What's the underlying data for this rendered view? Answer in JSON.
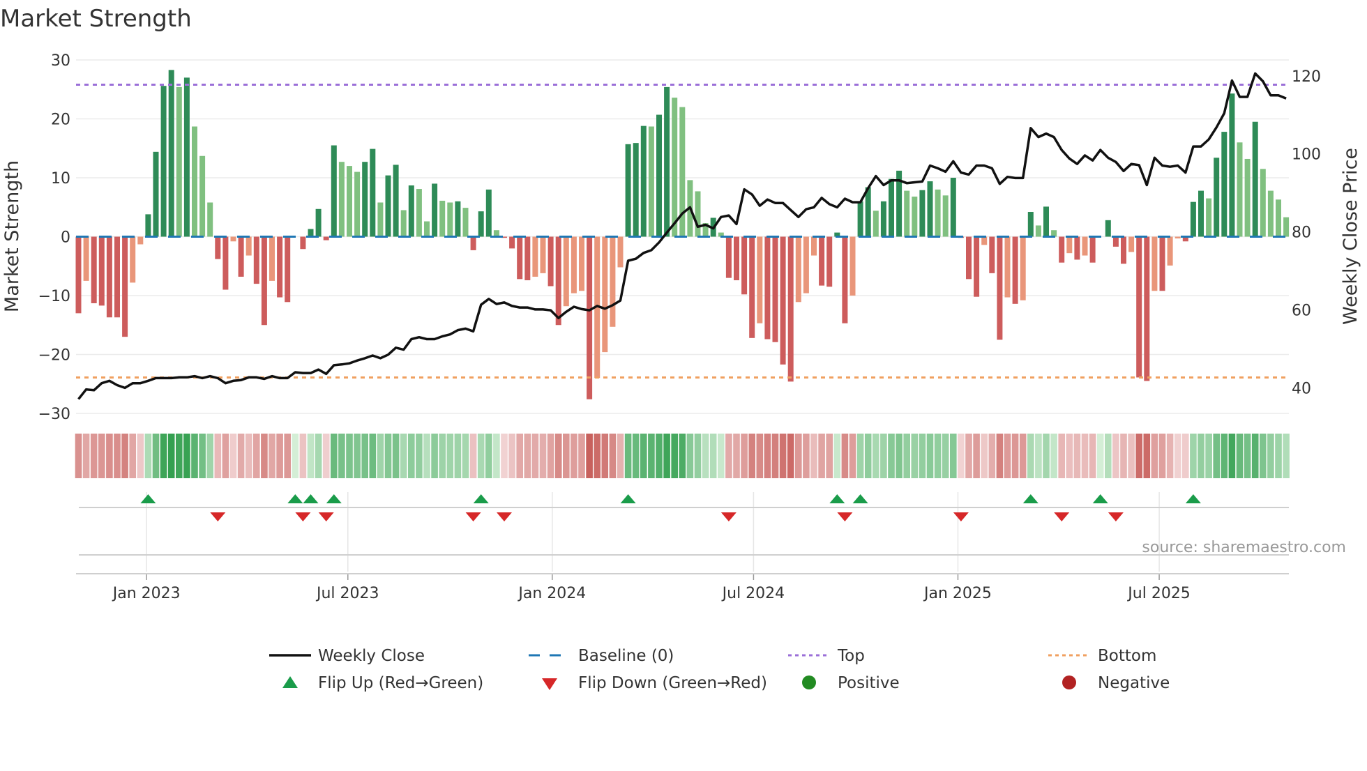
{
  "chart_data": {
    "type": "bar",
    "title": "Market Strength",
    "ylabel": "Market Strength",
    "y2label": "Weekly Close Price",
    "ylim": [
      -30,
      30
    ],
    "y2lim": [
      40,
      120
    ],
    "yticks": [
      30,
      20,
      10,
      0,
      -10,
      -20,
      -30
    ],
    "ytick_labels": [
      "30",
      "20",
      "10",
      "0",
      "−10",
      "−20",
      "−30"
    ],
    "y2ticks": [
      120,
      100,
      80,
      60,
      40
    ],
    "y2tick_labels": [
      "120",
      "100",
      "80",
      "60",
      "40"
    ],
    "xtick_labels": [
      "Jan 2023",
      "Jul 2023",
      "Jan 2024",
      "Jul 2024",
      "Jan 2025",
      "Jul 2025"
    ],
    "xtick_week_index": [
      8.8,
      34.8,
      61.2,
      87.2,
      113.6,
      139.6
    ],
    "grid": true,
    "top_level": 25.8,
    "bottom_level": -23.9,
    "baseline": 0,
    "strength": [
      -13,
      -7.5,
      -11.3,
      -11.7,
      -13.7,
      -13.7,
      -17,
      -7.8,
      -1.3,
      3.8,
      14.4,
      25.6,
      28.3,
      25.4,
      27,
      18.7,
      13.7,
      5.8,
      -3.8,
      -9,
      -0.8,
      -6.8,
      -3.2,
      -8,
      -15,
      -7.5,
      -10.3,
      -11.1,
      0,
      -2.1,
      1.3,
      4.7,
      -0.6,
      15.5,
      12.7,
      12,
      11,
      12.7,
      14.9,
      5.8,
      10.4,
      12.2,
      4.5,
      8.7,
      8.1,
      2.6,
      9,
      6.1,
      5.8,
      6,
      4.9,
      -2.3,
      4.3,
      8,
      1.1,
      -0.2,
      -2,
      -7.2,
      -7.4,
      -6.8,
      -6.2,
      -8.4,
      -15,
      -11.8,
      -9.6,
      -9.2,
      -27.6,
      -24,
      -19.6,
      -15.3,
      -5.2,
      15.7,
      15.9,
      18.8,
      18.7,
      20.7,
      25.4,
      23.6,
      22,
      9.6,
      7.7,
      2.3,
      3.2,
      0.7,
      -7,
      -7.4,
      -9.8,
      -17.2,
      -14.7,
      -17.4,
      -17.9,
      -21.7,
      -24.6,
      -11.1,
      -9.6,
      -3.2,
      -8.3,
      -8.5,
      0.7,
      -14.7,
      -10,
      6,
      8.4,
      4.4,
      6,
      9.8,
      11.2,
      7.8,
      6.8,
      7.9,
      9.4,
      8,
      7,
      10,
      -0.2,
      -7.2,
      -10.2,
      -1.4,
      -6.2,
      -17.5,
      -10.3,
      -11.4,
      -10.8,
      4.2,
      1.9,
      5.1,
      1.1,
      -4.4,
      -2.8,
      -3.9,
      -3.2,
      -4.4,
      0,
      2.8,
      -1.7,
      -4.6,
      -2.6,
      -23.9,
      -24.5,
      -9.2,
      -9.2,
      -4.9,
      -0.3,
      -0.8,
      5.9,
      7.8,
      6.5,
      13.4,
      17.8,
      24.3,
      16,
      13.2,
      19.5,
      11.5,
      7.8,
      6.3,
      3.3
    ],
    "weekly_close": [
      37.1,
      39.6,
      39.4,
      41.2,
      41.8,
      40.7,
      40,
      41.2,
      41.2,
      41.8,
      42.5,
      42.5,
      42.5,
      42.7,
      42.7,
      43,
      42.5,
      43,
      42.5,
      41.2,
      41.8,
      42,
      42.7,
      42.7,
      42.3,
      43,
      42.5,
      42.5,
      44,
      43.8,
      43.8,
      44.7,
      43.6,
      45.8,
      46,
      46.3,
      47,
      47.6,
      48.3,
      47.6,
      48.5,
      50.3,
      49.8,
      52.5,
      53,
      52.5,
      52.5,
      53.2,
      53.7,
      54.8,
      55.2,
      54.5,
      61.3,
      62.8,
      61.5,
      61.9,
      61,
      60.6,
      60.6,
      60.1,
      60.1,
      59.9,
      57.9,
      59.5,
      60.8,
      60.2,
      59.9,
      61,
      60.3,
      61.2,
      62.4,
      72.6,
      73.1,
      74.6,
      75.3,
      77.3,
      79.8,
      82.2,
      84.7,
      86.3,
      81.3,
      81.8,
      80.9,
      83.8,
      84.2,
      82,
      90.9,
      89.6,
      86.7,
      88.3,
      87.4,
      87.4,
      85.6,
      83.8,
      85.8,
      86.3,
      88.7,
      87.1,
      86.3,
      88.5,
      87.6,
      87.6,
      91.2,
      94.3,
      92,
      93.2,
      93.2,
      92.5,
      92.7,
      92.9,
      97,
      96.3,
      95.4,
      98.1,
      95.2,
      94.7,
      97,
      97,
      96.3,
      92.3,
      94.1,
      93.8,
      93.8,
      106.6,
      104.3,
      105.2,
      104.3,
      101,
      98.8,
      97.4,
      99.6,
      98.3,
      101,
      99,
      97.9,
      95.6,
      97.4,
      97.1,
      92,
      99,
      97,
      96.7,
      97,
      95.2,
      101.9,
      101.9,
      103.7,
      106.8,
      110.4,
      118.8,
      114.6,
      114.6,
      120.6,
      118.6,
      115,
      115,
      114.2
    ],
    "flip_up_week_index": [
      9,
      28,
      30,
      33,
      52,
      71,
      98,
      101,
      123,
      132,
      144
    ],
    "flip_down_week_index": [
      18,
      29,
      32,
      51,
      55,
      84,
      99,
      114,
      127,
      134
    ],
    "legend": {
      "placement": "bottom",
      "items": [
        {
          "label": "Weekly Close",
          "marker": "line-solid"
        },
        {
          "label": "Baseline (0)",
          "marker": "line-dashed"
        },
        {
          "label": "Top",
          "marker": "line-dotted"
        },
        {
          "label": "Bottom",
          "marker": "line-dotted"
        },
        {
          "label": "Flip Up (Red→Green)",
          "marker": "triangle-up"
        },
        {
          "label": "Flip Down (Green→Red)",
          "marker": "triangle-down"
        },
        {
          "label": "Positive",
          "marker": "circle"
        },
        {
          "label": "Negative",
          "marker": "circle"
        }
      ]
    },
    "annotation": "source: sharemaestro.com"
  },
  "colors": {
    "green_strong": "#2e8b57",
    "green_weak": "#80c080",
    "red_strong": "#cd5c5c",
    "red_weak": "#e9967a",
    "close_line": "#111111",
    "baseline": "#1f77b4",
    "top": "#9b6fd8",
    "bottom": "#f0a060",
    "flip_up": "#1a9c4a",
    "flip_down": "#d62728",
    "positive": "#228b22",
    "negative": "#b22222"
  }
}
